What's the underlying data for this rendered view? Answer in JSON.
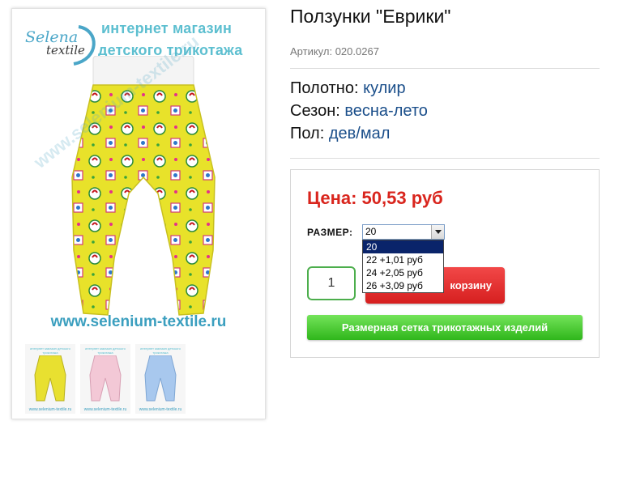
{
  "product": {
    "title": "Ползунки \"Еврики\"",
    "sku_label": "Артикул:",
    "sku_value": "020.0267"
  },
  "image": {
    "logo_word1": "Selena",
    "logo_word2": "textile",
    "headline_line1": "интернет магазин",
    "headline_line2": "детского трикотажа",
    "url": "www.selenium-textile.ru",
    "watermark": "www.selenium-textile.ru",
    "thumbnails": [
      {
        "caption": "www.selenium-textile.ru",
        "head": "интернет магазин детского трикотажа",
        "color": "#e8e030"
      },
      {
        "caption": "www.selenium-textile.ru",
        "head": "интернет магазин детского трикотажа",
        "color": "#f3c8d6"
      },
      {
        "caption": "www.selenium-textile.ru",
        "head": "интернет магазин детского трикотажа",
        "color": "#a8c8ee"
      }
    ]
  },
  "attributes": [
    {
      "label": "Полотно:",
      "value": "кулир"
    },
    {
      "label": "Сезон:",
      "value": "весна-лето"
    },
    {
      "label": "Пол:",
      "value": "дев/мал"
    }
  ],
  "purchase": {
    "price": "Цена: 50,53 руб",
    "size_label": "РАЗМЕР:",
    "size_selected": "20",
    "size_options": [
      "20",
      "22 +1,01 руб",
      "24 +2,05 руб",
      "26 +3,09 руб"
    ],
    "quantity": "1",
    "cart_button": "корзину",
    "size_chart_button": "Размерная сетка трикотажных изделий"
  },
  "colors": {
    "price": "#d9251d",
    "attribute_value": "#1a4e8a",
    "cart_button": "#e23030",
    "size_chart_button": "#3fc02a",
    "brand_blue": "#3b9fbf"
  }
}
